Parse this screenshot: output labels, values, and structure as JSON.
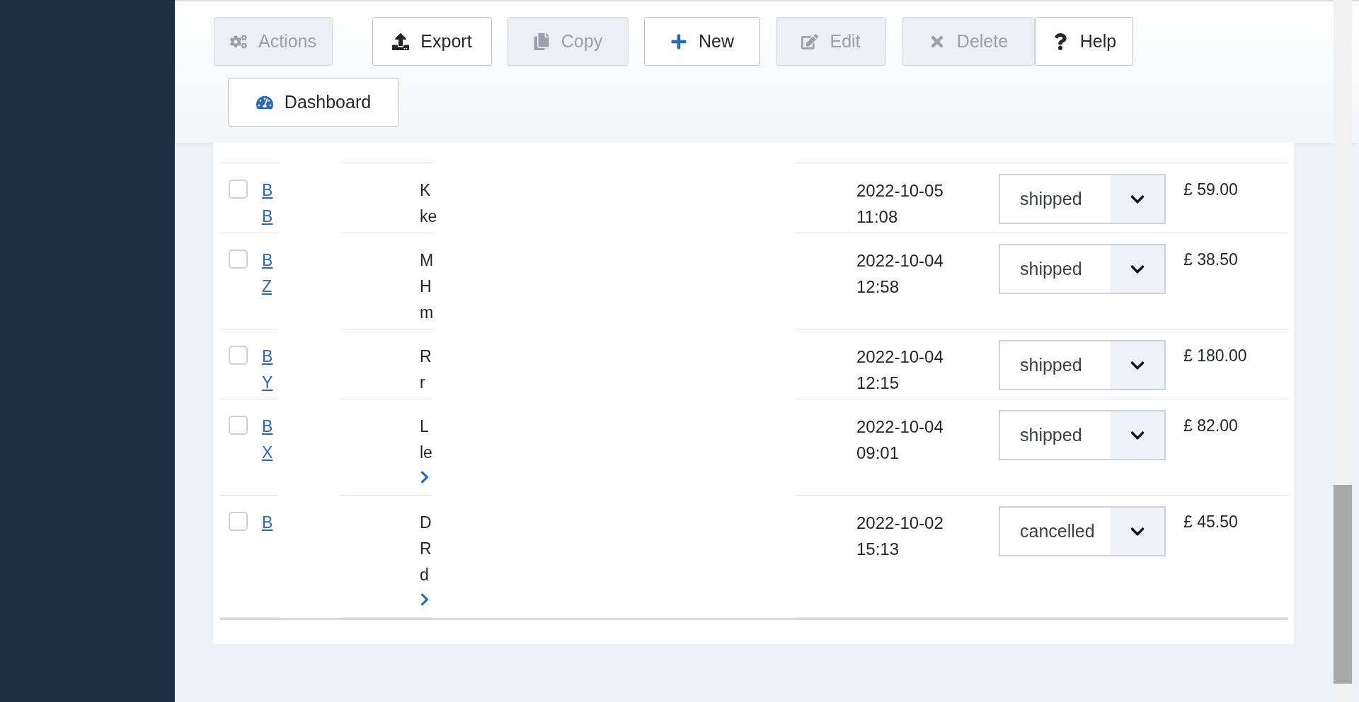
{
  "toolbar": {
    "buttons": [
      {
        "label": "Actions",
        "disabled": true
      },
      {
        "label": "Export",
        "disabled": false
      },
      {
        "label": "Copy",
        "disabled": true
      },
      {
        "label": "New",
        "disabled": false
      },
      {
        "label": "Edit",
        "disabled": true
      },
      {
        "label": "Delete",
        "disabled": true
      },
      {
        "label": "Help",
        "disabled": false
      },
      {
        "label": "Dashboard",
        "disabled": false
      }
    ]
  },
  "table": {
    "rows": [
      {
        "checked": false,
        "id_lines": [
          "B",
          "B"
        ],
        "customer_lines": [
          "K",
          "ke"
        ],
        "more": false,
        "date": "2022-10-05",
        "time": "11:08",
        "status": "shipped",
        "price": "£ 59.00"
      },
      {
        "checked": false,
        "id_lines": [
          "B",
          "Z"
        ],
        "customer_lines": [
          "M",
          "H",
          "m"
        ],
        "more": false,
        "date": "2022-10-04",
        "time": "12:58",
        "status": "shipped",
        "price": "£ 38.50"
      },
      {
        "checked": false,
        "id_lines": [
          "B",
          "Y"
        ],
        "customer_lines": [
          "R",
          "r"
        ],
        "more": false,
        "date": "2022-10-04",
        "time": "12:15",
        "status": "shipped",
        "price": "£ 180.00"
      },
      {
        "checked": false,
        "id_lines": [
          "B",
          "X"
        ],
        "customer_lines": [
          "L",
          "le"
        ],
        "more": true,
        "date": "2022-10-04",
        "time": "09:01",
        "status": "shipped",
        "price": "£ 82.00"
      },
      {
        "checked": false,
        "id_lines": [
          "B"
        ],
        "customer_lines": [
          "D",
          "R",
          "d"
        ],
        "more": true,
        "date": "2022-10-02",
        "time": "15:13",
        "status": "cancelled",
        "price": "£ 45.50"
      }
    ]
  }
}
